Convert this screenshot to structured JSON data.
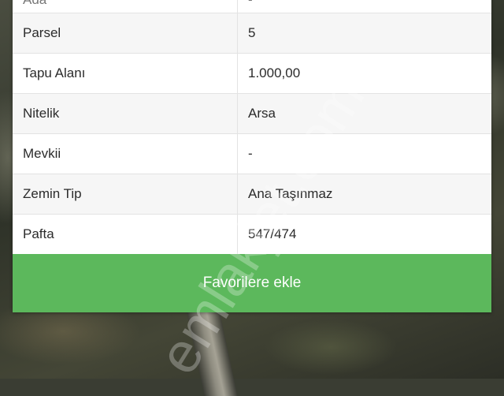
{
  "rows": [
    {
      "label": "Ada",
      "value": "-"
    },
    {
      "label": "Parsel",
      "value": "5"
    },
    {
      "label": "Tapu Alanı",
      "value": "1.000,00"
    },
    {
      "label": "Nitelik",
      "value": "Arsa"
    },
    {
      "label": "Mevkii",
      "value": "-"
    },
    {
      "label": "Zemin Tip",
      "value": "Ana Taşınmaz"
    },
    {
      "label": "Pafta",
      "value": "547/474"
    }
  ],
  "favorite_button": "Favorilere ekle",
  "watermark": "emlakjet.com",
  "colors": {
    "button": "#5cb85c",
    "card": "#ffffff",
    "row_alt": "#f6f6f6"
  }
}
